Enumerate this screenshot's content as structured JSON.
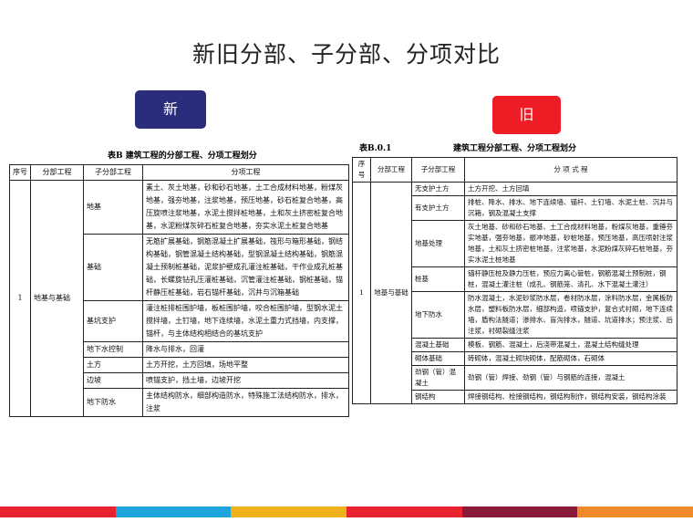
{
  "title": "新旧分部、子分部、分项对比",
  "badges": {
    "new": "新",
    "old": "旧"
  },
  "new_table": {
    "caption": "表B  建筑工程的分部工程、分项工程划分",
    "headers": [
      "序号",
      "分部工程",
      "子分部工程",
      "分项工程"
    ],
    "seq": "1",
    "division": "地基与基础",
    "rows": [
      {
        "sub": "地基",
        "items": "素土、灰土地基，砂和砂石地基，土工合成材料地基，粉煤灰地基，强夯地基，注浆地基，预压地基，砂石桩复合地基，高压旋喷注浆地基，水泥土搅拌桩地基，土和灰土挤密桩复合地基，水泥粉煤灰碎石桩复合地基，夯实水泥土桩复合地基"
      },
      {
        "sub": "基础",
        "items": "无筋扩展基础，钢筋混凝土扩展基础，筏形与箱形基础，钢结构基础，钢管混凝土结构基础，型钢混凝土结构基础，钢筋混凝土预制桩基础，泥浆护壁成孔灌注桩基础，干作业成孔桩基础，长螺旋钻孔压灌桩基础，沉管灌注桩基础，钢桩基础，锚杆静压桩基础，岩石锚杆基础，沉井与沉箱基础"
      },
      {
        "sub": "基坑支护",
        "items": "灌注桩排桩围护墙，板桩围护墙，咬合桩围护墙，型钢水泥土搅拌墙，土钉墙，地下连续墙，水泥土重力式挡墙，内支撑，锚杆，与主体结构相结合的基坑支护"
      },
      {
        "sub": "地下水控制",
        "items": "降水与排水，回灌"
      },
      {
        "sub": "土方",
        "items": "土方开挖，土方回填，场地平整"
      },
      {
        "sub": "边坡",
        "items": "喷锚支护，挡土墙，边坡开挖"
      },
      {
        "sub": "地下防水",
        "items": "主体结构防水，细部构造防水，特殊施工法结构防水，排水，注浆"
      }
    ]
  },
  "old_table": {
    "caption_no": "表B.0.1",
    "caption": "建筑工程分部工程、分项工程划分",
    "headers": [
      "序号",
      "分部工程",
      "子分部工程",
      "分  项  式  程"
    ],
    "seq": "1",
    "division": "地基与基础",
    "rows": [
      {
        "sub": "无支护土方",
        "items": "土方开挖、土方回填"
      },
      {
        "sub": "有支护土方",
        "items": "排桩、降水、排水、地下连续墙、锚杆、土钉墙、水泥土桩、沉井与沉箱，钢及混凝土支撑"
      },
      {
        "sub": "地基处理",
        "items": "灰土地基、砂和砂石地基、土工合成材料地基，粉煤灰地基，重锤夯实地基，强夯地基，振冲地基，砂桩地基，预压地基，高压喷射注浆地基，土和灰土挤密桩地基，注浆地基，水泥粉煤灰碎石桩地基，夯实水泥土桩地基"
      },
      {
        "sub": "桩基",
        "items": "锚杆静压桩及静力压桩，预应力离心管桩，钢筋混凝土预制桩，钢桩，混凝土灌注桩（成孔、钢筋笼、清孔、水下混凝土灌注）"
      },
      {
        "sub": "地下防水",
        "items": "防水混凝土，水泥砂浆防水层，卷材防水层，涂料防水层，金属板防水层，塑料板防水层，细部构造，喷锚支护，复合式衬砌，地下连续墙，盾构法隧道；渗排水、盲沟排水，隧道、坑道排水；预注浆、后注浆，衬砌裂缝注浆"
      },
      {
        "sub": "混凝土基础",
        "items": "模板、钢筋、混凝土，后浇带混凝土，混凝土结构缝处理"
      },
      {
        "sub": "砌体基础",
        "items": "砖砌体，混凝土砌块砌体，配筋砌体，石砌体"
      },
      {
        "sub": "劲钢（管）混凝土",
        "items": "劲钢（管）焊接、劲钢（管）与钢筋的连接，混凝土"
      },
      {
        "sub": "钢结构",
        "items": "焊接钢结构、栓接钢结构，钢结构制作，钢结构安装，钢结构涂装"
      }
    ]
  },
  "bottom_bar_colors": [
    "#e8232f",
    "#1ea5dc",
    "#f0b21c",
    "#e8232f",
    "#8b1a3a",
    "#f0892a"
  ]
}
